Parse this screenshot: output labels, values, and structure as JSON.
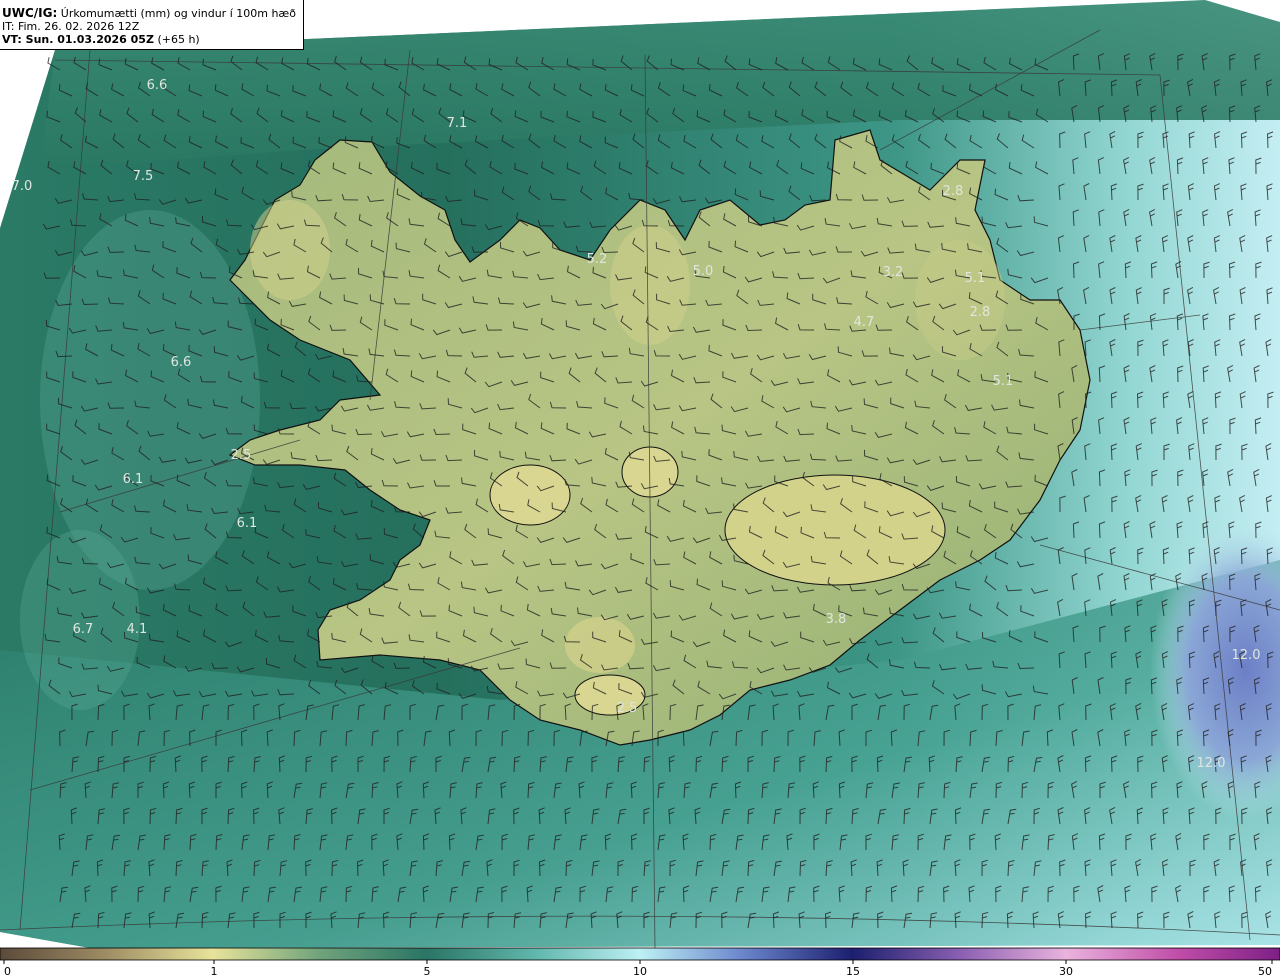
{
  "header": {
    "product": "UWC/IG:",
    "title": "Úrkomumætti (mm) og vindur í 100m hæð",
    "it_line": "IT: Fim. 26. 02. 2026 12Z",
    "vt_prefix": "VT: Sun. 01.03.2026 05Z",
    "vt_suffix": "(+65 h)"
  },
  "map": {
    "region": "Iceland",
    "colors": {
      "ocean_dark": "#1f6f5c",
      "ocean_mid": "#2e8573",
      "land_low": "#7fa46d",
      "land_high": "#d7d690",
      "sea_light": "#8fd3cf",
      "sea_pale": "#bfeaf0",
      "blue_high": "#6e84c9",
      "coast": "#111111",
      "grid": "#333333"
    },
    "value_labels": [
      "6.6",
      "7.1",
      "7.0",
      "7.5",
      "6.6",
      "6.1",
      "6.1",
      "6.7",
      "4.1",
      "2.5",
      "5.2",
      "5.0",
      "3.2",
      "4.7",
      "5.1",
      "2.8",
      "2.8",
      "5.1",
      "12.0",
      "12.0",
      "3.8",
      "2.5"
    ]
  },
  "colorbar": {
    "ticks": [
      "0",
      "1",
      "5",
      "10",
      "15",
      "30",
      "50"
    ]
  }
}
